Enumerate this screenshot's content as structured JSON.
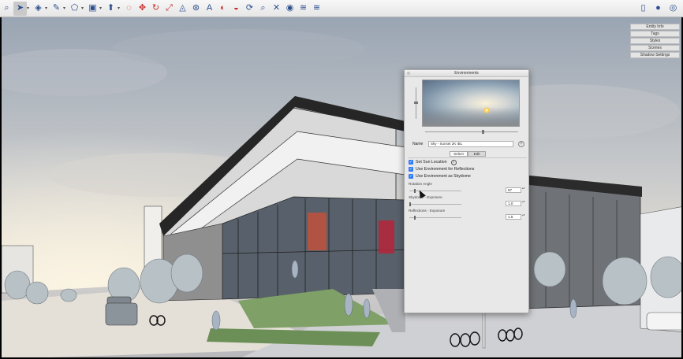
{
  "toolbar": {
    "tools": [
      {
        "name": "search-icon",
        "glyph": "⌕"
      },
      {
        "name": "select-arrow-icon",
        "glyph": "➤"
      },
      {
        "name": "eraser-icon",
        "glyph": "◈"
      },
      {
        "name": "pencil-icon",
        "glyph": "✎"
      },
      {
        "name": "polygon-icon",
        "glyph": "⬠"
      },
      {
        "name": "rectangle-icon",
        "glyph": "▣"
      },
      {
        "name": "push-pull-icon",
        "glyph": "⬆"
      },
      {
        "name": "offset-icon",
        "glyph": "◌"
      },
      {
        "name": "move-icon",
        "glyph": "✥"
      },
      {
        "name": "rotate-icon",
        "glyph": "↻"
      },
      {
        "name": "scale-icon",
        "glyph": "⤢"
      },
      {
        "name": "protractor-icon",
        "glyph": "◬"
      },
      {
        "name": "tape-measure-icon",
        "glyph": "⊛"
      },
      {
        "name": "text-icon",
        "glyph": "A"
      },
      {
        "name": "section-plane-icon",
        "glyph": "◐"
      },
      {
        "name": "paint-bucket-icon",
        "glyph": "◒"
      },
      {
        "name": "orbit-icon",
        "glyph": "⟳"
      },
      {
        "name": "zoom-icon",
        "glyph": "⌕"
      },
      {
        "name": "zoom-extents-icon",
        "glyph": "✕"
      },
      {
        "name": "warehouse-icon",
        "glyph": "◉"
      },
      {
        "name": "extension-warehouse-icon",
        "glyph": "≋"
      },
      {
        "name": "layout-icon",
        "glyph": "≋"
      }
    ],
    "right_icons": [
      {
        "name": "document-icon",
        "glyph": "▯"
      },
      {
        "name": "account-icon",
        "glyph": "●"
      },
      {
        "name": "help-icon",
        "glyph": "◎"
      }
    ]
  },
  "tray": {
    "items": [
      "Entity Info",
      "Tags",
      "Styles",
      "Scenes",
      "Shadow Settings"
    ]
  },
  "panel": {
    "title": "Environments",
    "name_label": "Name",
    "name_value": "Sky - Sunset 2K IBL",
    "add_symbol": "+",
    "tabs": [
      "Select",
      "Edit"
    ],
    "checkboxes": [
      {
        "label": "Set Sun Location",
        "checked": true
      },
      {
        "label": "Use Environment for Reflections",
        "checked": true
      },
      {
        "label": "Use Environment as Skydome",
        "checked": true
      }
    ],
    "sliders": [
      {
        "label": "Rotation Angle",
        "value": "57",
        "fraction": 0.1
      },
      {
        "label": "Skydome - Exposure",
        "value": "1.0",
        "fraction": 0.0
      },
      {
        "label": "Reflections - Exposure",
        "value": "1.5",
        "fraction": 0.1
      }
    ],
    "info_symbol": "i",
    "check_symbol": "✓",
    "stepper_symbols": "▴▾"
  },
  "colors": {
    "toolbar_bg": "#ececec",
    "panel_bg": "#e8e8e8",
    "checkbox_accent": "#2f7cf6",
    "sky_warm": "#f1e6cf",
    "sky_cool": "#8e9aa8"
  }
}
